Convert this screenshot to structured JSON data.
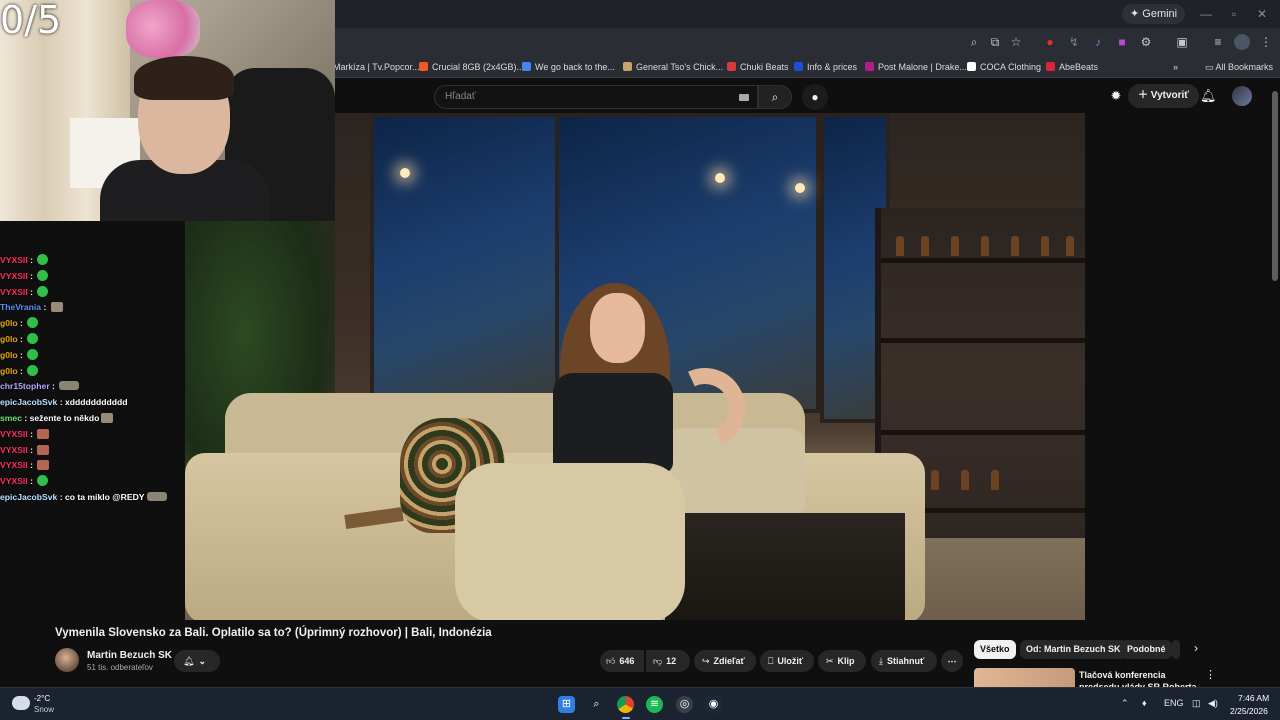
{
  "overlay": {
    "score": "0/5"
  },
  "browser": {
    "gemini_label": "Gemini",
    "bookmarks": [
      {
        "label": "Markíza | Tv.Popcor...",
        "color": "#3a78d6"
      },
      {
        "label": "Crucial 8GB (2x4GB)...",
        "color": "#f05a22"
      },
      {
        "label": "We go back to the...",
        "color": "#4285f4"
      },
      {
        "label": "General Tso's Chick...",
        "color": "#c9a36b"
      },
      {
        "label": "Chuki Beats",
        "color": "#d63b3b"
      },
      {
        "label": "Info & prices",
        "color": "#1b4fd8"
      },
      {
        "label": "Post Malone | Drake...",
        "color": "#b01e8a"
      },
      {
        "label": "COCA Clothing",
        "color": "#222222"
      },
      {
        "label": "AbeBeats",
        "color": "#d9263c"
      }
    ],
    "all_bookmarks_label": "All Bookmarks"
  },
  "youtube": {
    "search_placeholder": "Hľadať",
    "create_label": "Vytvoriť",
    "video_title": "Vymenila Slovensko za Bali. Oplatilo sa to? (Úprimný rozhovor) | Bali, Indonézia",
    "channel_name": "Martin Bezuch SK",
    "channel_subs": "51 tis. odberateľov",
    "like_count": "646",
    "dislike_count": "12",
    "share_label": "Zdieľať",
    "save_label": "Uložiť",
    "clip_label": "Klip",
    "download_label": "Stiahnuť",
    "chips": [
      {
        "label": "Všetko",
        "active": true
      },
      {
        "label": "Od: Martin Bezuch SK",
        "active": false
      },
      {
        "label": "Podobné",
        "active": false
      }
    ],
    "recommendation_title": "Tlačová konferencia predsedu vlády SR Roberta Fica po"
  },
  "chat": [
    {
      "user": "VYXSII",
      "color": "#ff2e63",
      "message": "",
      "emote": "check"
    },
    {
      "user": "VYXSII",
      "color": "#ff2e63",
      "message": "",
      "emote": "check"
    },
    {
      "user": "VYXSII",
      "color": "#ff2e63",
      "message": "",
      "emote": "check"
    },
    {
      "user": "TheVrania",
      "color": "#5c8dff",
      "message": "",
      "emote": "face"
    },
    {
      "user": "g0lo",
      "color": "#e8a21a",
      "message": "",
      "emote": "check"
    },
    {
      "user": "g0lo",
      "color": "#e8a21a",
      "message": "",
      "emote": "check"
    },
    {
      "user": "g0lo",
      "color": "#e8a21a",
      "message": "",
      "emote": "check"
    },
    {
      "user": "g0lo",
      "color": "#e8a21a",
      "message": "",
      "emote": "check"
    },
    {
      "user": "chr15topher",
      "color": "#b7a6ff",
      "message": "",
      "emote": "wide"
    },
    {
      "user": "epicJacobSvk",
      "color": "#b9e0ff",
      "message": "xddddddddddd",
      "emote": ""
    },
    {
      "user": "smec",
      "color": "#6de07a",
      "message": "sežente to někdo",
      "emote": "face"
    },
    {
      "user": "VYXSII",
      "color": "#ff2e63",
      "message": "",
      "emote": "sq"
    },
    {
      "user": "VYXSII",
      "color": "#ff2e63",
      "message": "",
      "emote": "sq"
    },
    {
      "user": "VYXSII",
      "color": "#ff2e63",
      "message": "",
      "emote": "sq"
    },
    {
      "user": "VYXSII",
      "color": "#ff2e63",
      "message": "",
      "emote": "check"
    },
    {
      "user": "epicJacobSvk",
      "color": "#b9e0ff",
      "message": "co ta miklo @REDY",
      "emote": "wide"
    }
  ],
  "taskbar": {
    "temperature": "-2°C",
    "condition": "Snow",
    "language": "ENG",
    "time": "7:46 AM",
    "date": "2/25/2026"
  }
}
